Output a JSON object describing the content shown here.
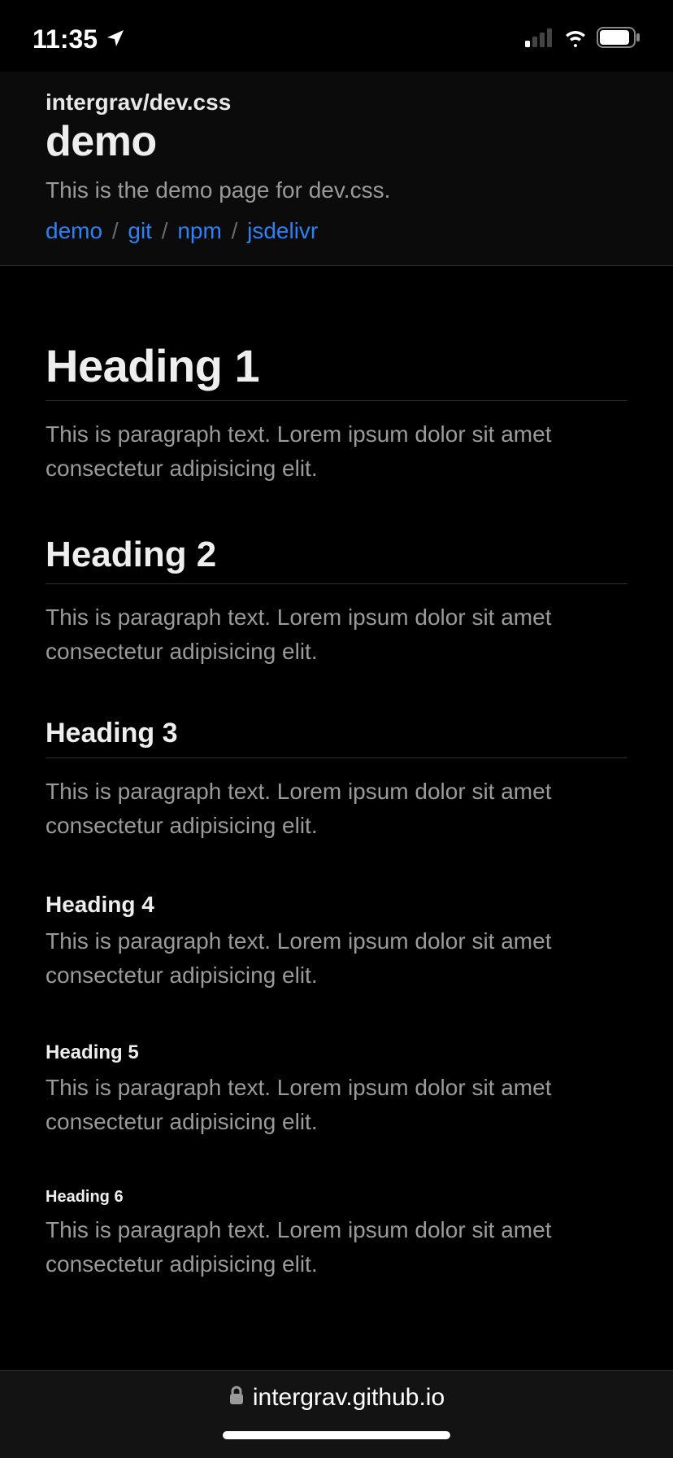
{
  "status": {
    "time": "11:35"
  },
  "header": {
    "subtitle": "intergrav/dev.css",
    "title": "demo",
    "description": "This is the demo page for dev.css.",
    "nav": {
      "links": [
        "demo",
        "git",
        "npm",
        "jsdelivr"
      ],
      "separator": "/"
    }
  },
  "sections": [
    {
      "heading": "Heading 1",
      "text": "This is paragraph text. Lorem ipsum dolor sit amet consectetur adipisicing elit."
    },
    {
      "heading": "Heading 2",
      "text": "This is paragraph text. Lorem ipsum dolor sit amet consectetur adipisicing elit."
    },
    {
      "heading": "Heading 3",
      "text": "This is paragraph text. Lorem ipsum dolor sit amet consectetur adipisicing elit."
    },
    {
      "heading": "Heading 4",
      "text": "This is paragraph text. Lorem ipsum dolor sit amet consectetur adipisicing elit."
    },
    {
      "heading": "Heading 5",
      "text": "This is paragraph text. Lorem ipsum dolor sit amet consectetur adipisicing elit."
    },
    {
      "heading": "Heading 6",
      "text": "This is paragraph text. Lorem ipsum dolor sit amet consectetur adipisicing elit."
    }
  ],
  "urlbar": {
    "domain": "intergrav.github.io"
  }
}
